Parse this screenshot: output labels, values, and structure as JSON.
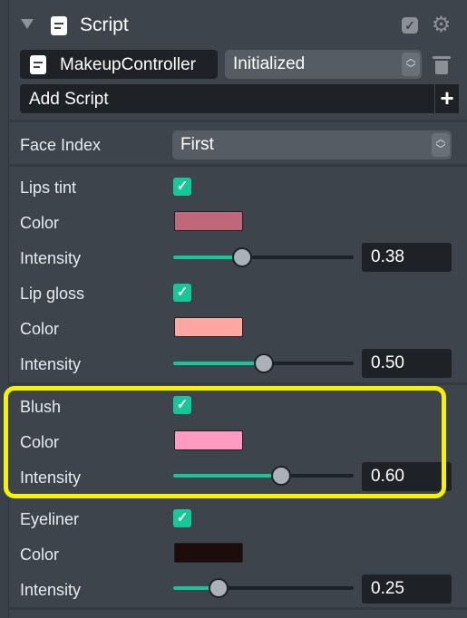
{
  "header": {
    "title": "Script",
    "toggle_icon": "check-icon",
    "settings_icon": "gear-icon"
  },
  "script": {
    "name": "MakeupController",
    "state": "Initialized",
    "add_label": "Add Script"
  },
  "face_index": {
    "label": "Face Index",
    "value": "First"
  },
  "groups": [
    {
      "enable_label": "Lips tint",
      "enabled": true,
      "color_label": "Color",
      "color": "#c0687a",
      "intensity_label": "Intensity",
      "intensity": "0.38",
      "intensity_fraction": 0.38
    },
    {
      "enable_label": "Lip gloss",
      "enabled": true,
      "color_label": "Color",
      "color": "#ffa6a1",
      "intensity_label": "Intensity",
      "intensity": "0.50",
      "intensity_fraction": 0.5
    },
    {
      "enable_label": "Blush",
      "enabled": true,
      "color_label": "Color",
      "color": "#ff9ac1",
      "intensity_label": "Intensity",
      "intensity": "0.60",
      "intensity_fraction": 0.6,
      "highlighted": true
    },
    {
      "enable_label": "Eyeliner",
      "enabled": true,
      "color_label": "Color",
      "color": "#1c0d0a",
      "intensity_label": "Intensity",
      "intensity": "0.25",
      "intensity_fraction": 0.25
    }
  ],
  "colors": {
    "accent": "#16c79a",
    "highlight": "#f7f300",
    "panel": "#3e444b",
    "field": "#1e2226"
  }
}
